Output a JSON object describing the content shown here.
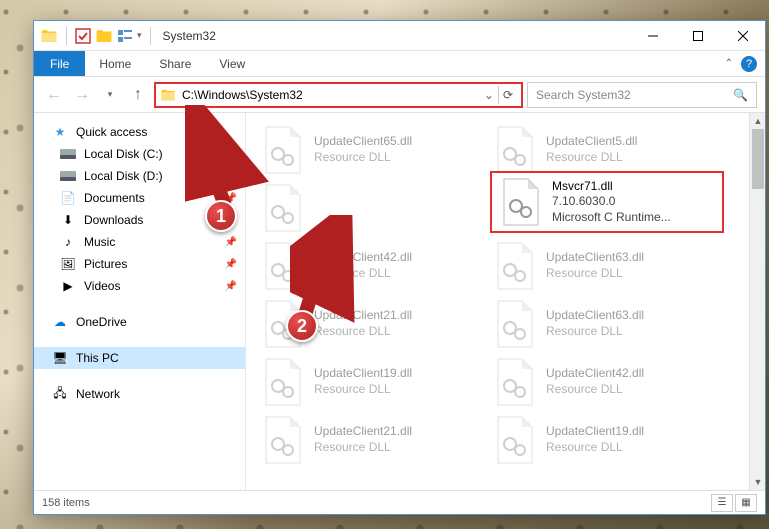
{
  "titlebar": {
    "title": "System32"
  },
  "ribbon": {
    "file": "File",
    "tabs": [
      "Home",
      "Share",
      "View"
    ]
  },
  "address": {
    "path": "C:\\Windows\\System32",
    "search_placeholder": "Search System32"
  },
  "nav": {
    "quick_access": "Quick access",
    "items": [
      {
        "label": "Local Disk (C:)",
        "icon": "drive"
      },
      {
        "label": "Local Disk (D:)",
        "icon": "drive"
      },
      {
        "label": "Documents",
        "icon": "doc"
      },
      {
        "label": "Downloads",
        "icon": "down"
      },
      {
        "label": "Music",
        "icon": "music"
      },
      {
        "label": "Pictures",
        "icon": "pic"
      },
      {
        "label": "Videos",
        "icon": "vid"
      }
    ],
    "onedrive": "OneDrive",
    "thispc": "This PC",
    "network": "Network"
  },
  "highlighted_file": {
    "name": "Msvcr71.dll",
    "version": "7.10.6030.0",
    "desc": "Microsoft C Runtime..."
  },
  "bg_files": [
    {
      "name": "UpdateClient65.dll",
      "desc": "Resource DLL"
    },
    {
      "name": "UpdateClient5.dll",
      "desc": "Resource DLL"
    },
    {
      "name": "",
      "desc": ""
    },
    {
      "name": "",
      "desc": ""
    },
    {
      "name": "UpdateClient42.dll",
      "desc": "Resource DLL"
    },
    {
      "name": "UpdateClient63.dll",
      "desc": "Resource DLL"
    },
    {
      "name": "UpdateClient21.dll",
      "desc": "Resource DLL"
    },
    {
      "name": "UpdateClient63.dll",
      "desc": "Resource DLL"
    },
    {
      "name": "UpdateClient19.dll",
      "desc": "Resource DLL"
    },
    {
      "name": "UpdateClient42.dll",
      "desc": "Resource DLL"
    },
    {
      "name": "UpdateClient21.dll",
      "desc": "Resource DLL"
    },
    {
      "name": "UpdateClient19.dll",
      "desc": "Resource DLL"
    }
  ],
  "status": {
    "count": "158 items"
  },
  "callouts": {
    "one": "1",
    "two": "2"
  }
}
